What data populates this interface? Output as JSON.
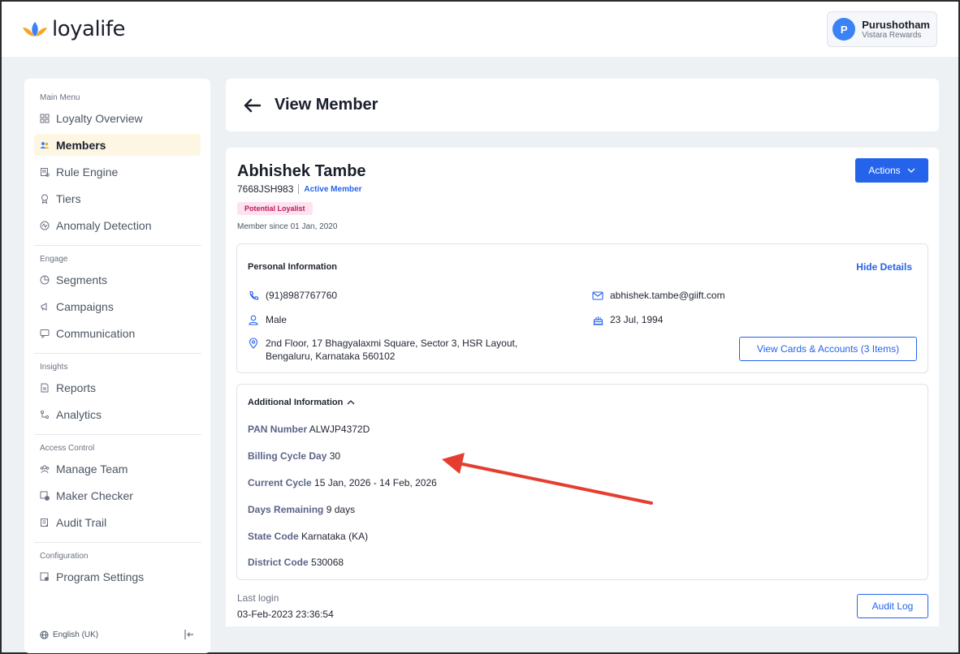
{
  "brand": {
    "name": "loyalife"
  },
  "user": {
    "initial": "P",
    "name": "Purushotham",
    "program": "Vistara Rewards"
  },
  "sidebar": {
    "sections": [
      {
        "title": "Main Menu",
        "items": [
          {
            "label": "Loyalty Overview",
            "icon": "grid-icon"
          },
          {
            "label": "Members",
            "icon": "users-icon",
            "active": true
          },
          {
            "label": "Rule Engine",
            "icon": "rule-icon"
          },
          {
            "label": "Tiers",
            "icon": "medal-icon"
          },
          {
            "label": "Anomaly Detection",
            "icon": "anomaly-icon"
          }
        ]
      },
      {
        "title": "Engage",
        "items": [
          {
            "label": "Segments",
            "icon": "pie-icon"
          },
          {
            "label": "Campaigns",
            "icon": "megaphone-icon"
          },
          {
            "label": "Communication",
            "icon": "message-icon"
          }
        ]
      },
      {
        "title": "Insights",
        "items": [
          {
            "label": "Reports",
            "icon": "report-icon"
          },
          {
            "label": "Analytics",
            "icon": "analytics-icon"
          }
        ]
      },
      {
        "title": "Access Control",
        "items": [
          {
            "label": "Manage Team",
            "icon": "team-icon"
          },
          {
            "label": "Maker Checker",
            "icon": "checker-icon"
          },
          {
            "label": "Audit Trail",
            "icon": "audit-icon"
          }
        ]
      },
      {
        "title": "Configuration",
        "items": [
          {
            "label": "Program Settings",
            "icon": "settings-icon"
          }
        ]
      }
    ],
    "language": "English (UK)"
  },
  "page": {
    "title": "View Member"
  },
  "member": {
    "name": "Abhishek Tambe",
    "id": "7668JSH983",
    "status": "Active Member",
    "badge": "Potential Loyalist",
    "since": "Member since 01 Jan, 2020",
    "actions_label": "Actions"
  },
  "personal": {
    "title": "Personal Information",
    "hide_label": "Hide Details",
    "phone": "(91)8987767760",
    "email": "abhishek.tambe@giift.com",
    "gender": "Male",
    "dob": "23 Jul, 1994",
    "address_line1": "2nd Floor, 17 Bhagyalaxmi Square, Sector 3, HSR Layout,",
    "address_line2": "Bengaluru, Karnataka 560102",
    "view_cards_label": "View Cards & Accounts (3 Items)"
  },
  "additional": {
    "title": "Additional Information",
    "fields": [
      {
        "label": "PAN Number",
        "value": "ALWJP4372D"
      },
      {
        "label": "Billing Cycle Day",
        "value": "30"
      },
      {
        "label": "Current Cycle",
        "value": "15 Jan, 2026 - 14 Feb, 2026"
      },
      {
        "label": "Days Remaining",
        "value": "9 days"
      },
      {
        "label": "State Code",
        "value": "Karnataka (KA)"
      },
      {
        "label": "District Code",
        "value": "530068"
      }
    ]
  },
  "footer": {
    "last_login_label": "Last login",
    "last_login_value": "03-Feb-2023 23:36:54",
    "audit_log_label": "Audit Log"
  },
  "colors": {
    "accent": "#2563eb",
    "annotation_arrow": "#e53e2f",
    "active_nav_bg": "#fdf6e3",
    "badge_bg": "#fde2ef"
  }
}
